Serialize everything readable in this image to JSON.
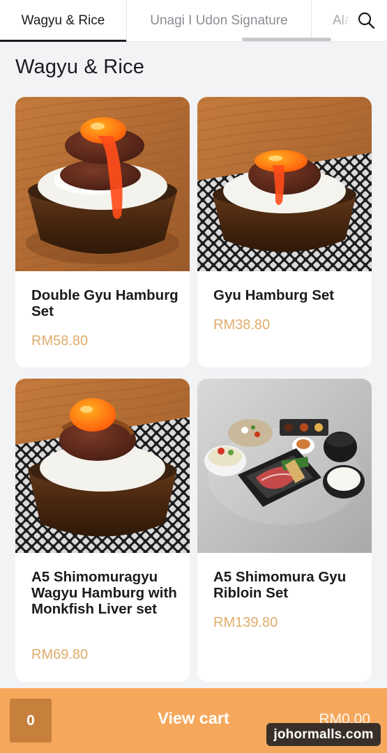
{
  "tabs": [
    {
      "label": "Wagyu & Rice"
    },
    {
      "label": "Unagi I Udon Signature"
    },
    {
      "label": "Ala"
    }
  ],
  "search": {
    "icon": "search-icon"
  },
  "section": {
    "title": "Wagyu & Rice"
  },
  "products": [
    {
      "name": "Double Gyu Hamburg Set",
      "price": "RM58.80"
    },
    {
      "name": "Gyu Hamburg Set",
      "price": "RM38.80"
    },
    {
      "name": "A5 Shimomuragyu Wagyu Hamburg with Monkfish Liver set",
      "price": "RM69.80"
    },
    {
      "name": "A5 Shimomura Gyu Ribloin Set",
      "price": "RM139.80"
    }
  ],
  "cart": {
    "count": "0",
    "label": "View cart",
    "total": "RM0.00"
  },
  "watermark": "johormalls.com",
  "colors": {
    "accent": "#f5a85c",
    "price": "#e0ad6c",
    "count_badge": "#c77f3c"
  }
}
